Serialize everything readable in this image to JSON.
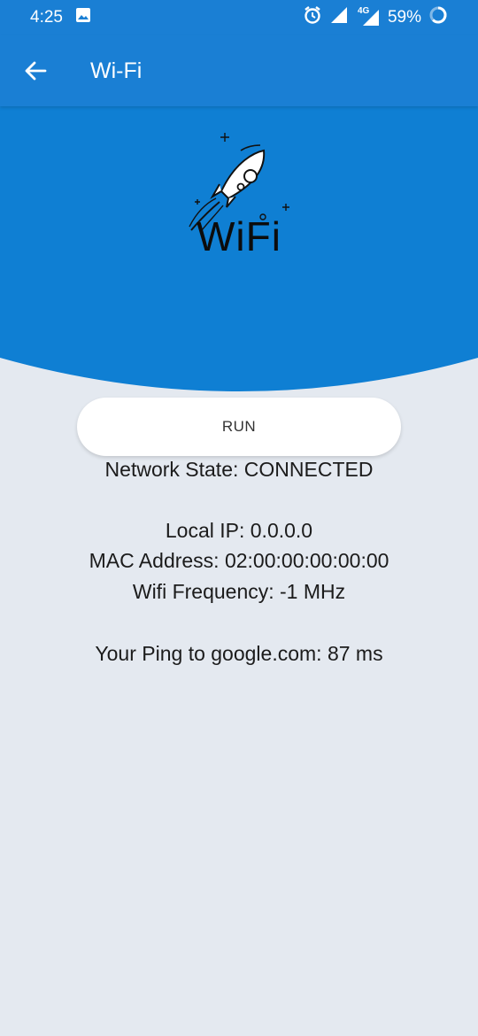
{
  "status_bar": {
    "time": "4:25",
    "network_badge": "4G",
    "battery": "59%",
    "icons": [
      "image-icon",
      "alarm-icon",
      "signal-icon",
      "signal-4g-icon",
      "battery-icon"
    ]
  },
  "app_bar": {
    "title": "Wi-Fi",
    "back_icon": "arrow-left-icon"
  },
  "hero": {
    "logo_text": "WiFi",
    "logo_icon": "rocket-icon",
    "colors": {
      "primary": "#1a7fd4",
      "background": "#e4e9f0"
    }
  },
  "main": {
    "run_label": "RUN",
    "network_state": "Network State: CONNECTED",
    "local_ip": "Local IP: 0.0.0.0",
    "mac_address": "MAC Address: 02:00:00:00:00:00",
    "wifi_frequency": "Wifi Frequency: -1 MHz",
    "ping": "Your Ping to google.com: 87 ms"
  }
}
